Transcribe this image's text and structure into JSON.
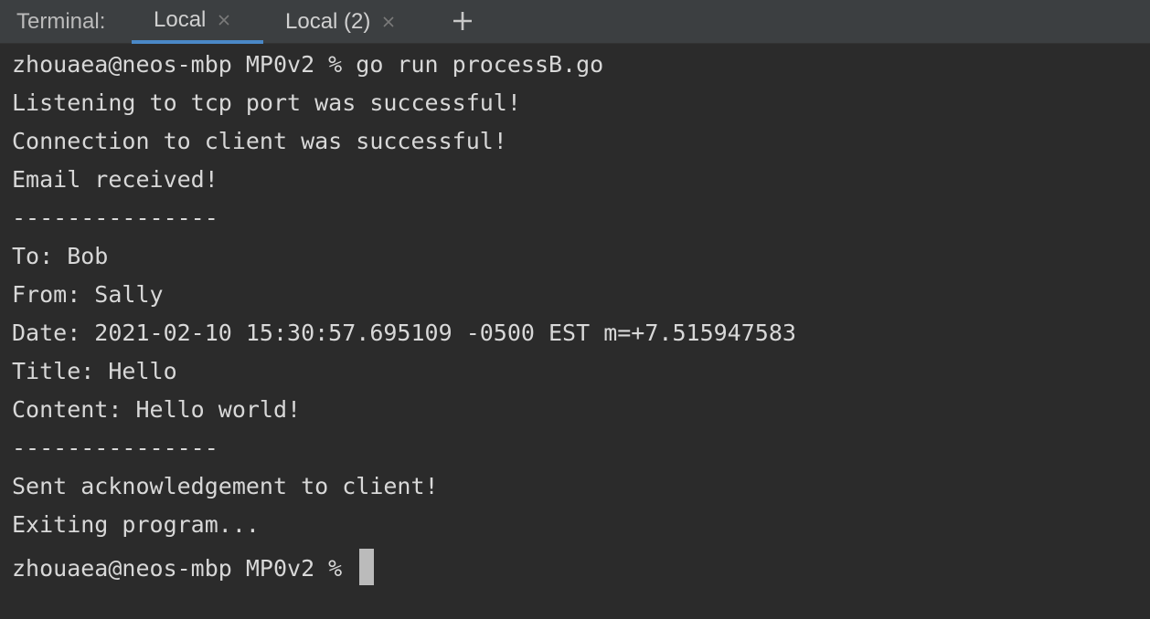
{
  "tabbar": {
    "label": "Terminal:",
    "tabs": [
      {
        "label": "Local",
        "active": true
      },
      {
        "label": "Local (2)",
        "active": false
      }
    ],
    "add_icon": "plus-icon",
    "close_icon": "close-icon"
  },
  "terminal": {
    "lines": [
      "zhouaea@neos-mbp MP0v2 % go run processB.go",
      "Listening to tcp port was successful!",
      "Connection to client was successful!",
      "Email received!",
      "---------------",
      "To: Bob",
      "From: Sally",
      "Date: 2021-02-10 15:30:57.695109 -0500 EST m=+7.515947583",
      "Title: Hello",
      "Content: Hello world!",
      "---------------",
      "Sent acknowledgement to client!",
      "Exiting program..."
    ],
    "prompt": "zhouaea@neos-mbp MP0v2 % "
  },
  "colors": {
    "background": "#2b2b2b",
    "tabbar": "#3c3f41",
    "active_tab_underline": "#4a88c7",
    "text": "#d8d8d8"
  }
}
